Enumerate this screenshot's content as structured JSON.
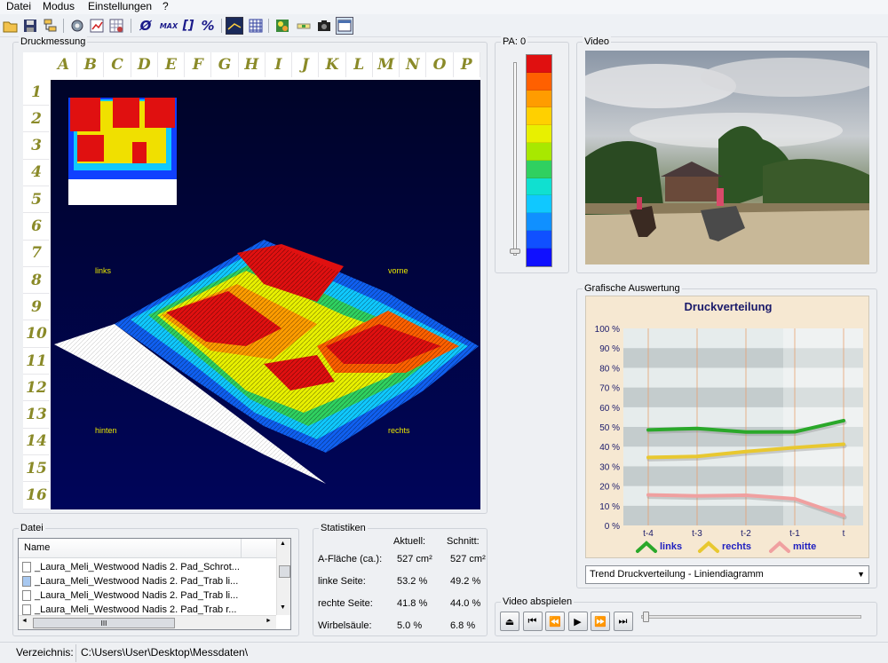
{
  "menu": [
    "Datei",
    "Modus",
    "Einstellungen",
    "?"
  ],
  "toolbar": {
    "icons": [
      "open-folder-icon",
      "save-icon",
      "tree-icon",
      "camera-settings-icon",
      "chart-check-icon",
      "grid-settings-icon",
      "average-icon",
      "max-icon",
      "brackets-icon",
      "percent-icon",
      "3d-view-icon",
      "grid-icon",
      "map-icon",
      "level-icon",
      "camera-icon",
      "window-icon"
    ],
    "avg_symbol": "Ø",
    "max_label": "MAX",
    "brackets_label": "[]",
    "percent_label": "%"
  },
  "druck": {
    "title": "Druckmessung",
    "columns": [
      "A",
      "B",
      "C",
      "D",
      "E",
      "F",
      "G",
      "H",
      "I",
      "J",
      "K",
      "L",
      "M",
      "N",
      "O",
      "P"
    ],
    "rows": [
      "1",
      "2",
      "3",
      "4",
      "5",
      "6",
      "7",
      "8",
      "9",
      "10",
      "11",
      "12",
      "13",
      "14",
      "15",
      "16"
    ],
    "labels": {
      "links": "links",
      "vorne": "vorne",
      "hinten": "hinten",
      "rechts": "rechts"
    }
  },
  "pa": {
    "label": "PA: 0",
    "scale_colors": [
      "#e01010",
      "#ff6000",
      "#ff9c00",
      "#ffd000",
      "#e8f000",
      "#a8e800",
      "#30d060",
      "#10e0d0",
      "#10c8ff",
      "#1090ff",
      "#1050ff",
      "#1010ff"
    ]
  },
  "video": {
    "title": "Video"
  },
  "grafik": {
    "title": "Grafische Auswertung",
    "selected": "Trend Druckverteilung - Liniendiagramm"
  },
  "chart_data": {
    "type": "line",
    "title": "Druckverteilung",
    "categories": [
      "t-4",
      "t-3",
      "t-2",
      "t-1",
      "t"
    ],
    "y_ticks": [
      "100 %",
      "90 %",
      "80 %",
      "70 %",
      "60 %",
      "50 %",
      "40 %",
      "30 %",
      "20 %",
      "10 %",
      "0 %"
    ],
    "ylim": [
      0,
      100
    ],
    "legend_position": "bottom",
    "series": [
      {
        "name": "links",
        "values": [
          48.5,
          49.2,
          47.4,
          47.5,
          53.2
        ],
        "color": "#2aa82a"
      },
      {
        "name": "rechts",
        "values": [
          34.5,
          35.0,
          37.5,
          39.5,
          41.2
        ],
        "color": "#e8c830"
      },
      {
        "name": "mitte",
        "values": [
          15.5,
          15.0,
          15.3,
          13.5,
          5.0
        ],
        "color": "#f0a0a0"
      }
    ]
  },
  "datei": {
    "title": "Datei",
    "col_name": "Name",
    "files": [
      "_Laura_Meli_Westwood Nadis 2. Pad_Schrot...",
      "_Laura_Meli_Westwood Nadis 2. Pad_Trab li...",
      "_Laura_Meli_Westwood Nadis 2. Pad_Trab li...",
      "_Laura_Meli_Westwood Nadis 2. Pad_Trab r..."
    ],
    "scroll_thumb": "III"
  },
  "statistiken": {
    "title": "Statistiken",
    "headers": {
      "aktuell": "Aktuell:",
      "schnitt": "Schnitt:"
    },
    "rows": [
      {
        "label": "A-Fläche (ca.):",
        "aktuell": "527 cm²",
        "schnitt": "527 cm²"
      },
      {
        "label": "linke Seite:",
        "aktuell": "53.2 %",
        "schnitt": "49.2 %"
      },
      {
        "label": "rechte Seite:",
        "aktuell": "41.8 %",
        "schnitt": "44.0 %"
      },
      {
        "label": "Wirbelsäule:",
        "aktuell": "5.0 %",
        "schnitt": "6.8 %"
      }
    ]
  },
  "video_abspielen": {
    "title": "Video abspielen",
    "buttons": [
      "eject-icon",
      "skip-start-icon",
      "rewind-icon",
      "play-icon",
      "fast-forward-icon",
      "skip-end-icon"
    ],
    "position": 0
  },
  "status": {
    "label": "Verzeichnis:",
    "path": "C:\\Users\\User\\Desktop\\Messdaten\\"
  }
}
